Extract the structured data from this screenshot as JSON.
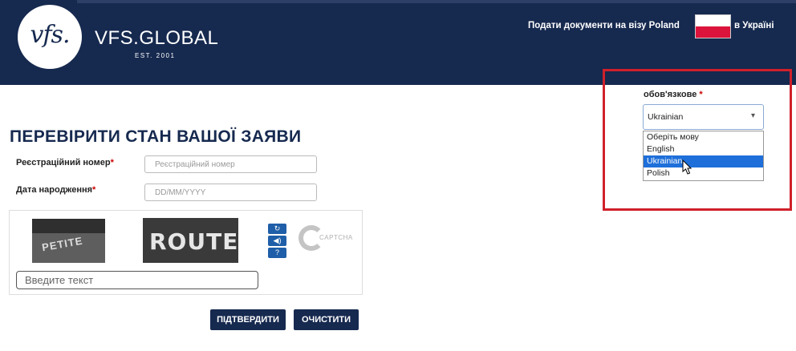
{
  "header": {
    "logo_text": "vfs.",
    "brand": "VFS.GLOBAL",
    "brand_est": "EST. 2001",
    "visa_prefix": "Подати документи на візу Poland",
    "visa_suffix": "в Україні",
    "flag_colors": [
      "#ffffff",
      "#dc143c"
    ]
  },
  "form": {
    "title": "ПЕРЕВІРИТИ СТАН ВАШОЇ ЗАЯВИ",
    "reg_label": "Реєстраційний номер",
    "reg_placeholder": "Реєстраційний номер",
    "dob_label": "Дата народження",
    "dob_placeholder": "DD/MM/YYYY",
    "required_mark": "*"
  },
  "captcha": {
    "image1_text": "PETITE",
    "image2_text": "ROUTE",
    "refresh_icon": "refresh-icon",
    "audio_icon": "speaker-icon",
    "help_icon": "help-icon",
    "refresh_glyph": "↻",
    "audio_glyph": "◀)",
    "help_glyph": "?",
    "brand_text": "CAPTCHA",
    "input_placeholder": "Введите текст"
  },
  "buttons": {
    "confirm": "ПІДТВЕРДИТИ",
    "clear": "ОЧИСТИТИ"
  },
  "language": {
    "label": "обов'язкове",
    "required_mark": "*",
    "selected": "Ukrainian",
    "chevron": "▾",
    "options": [
      "Оберіть мову",
      "English",
      "Ukrainian",
      "Polish"
    ],
    "highlighted_index": 2
  },
  "colors": {
    "header_bg": "#16294f",
    "accent_red": "#d0202a",
    "selection_blue": "#1e6fd9"
  }
}
